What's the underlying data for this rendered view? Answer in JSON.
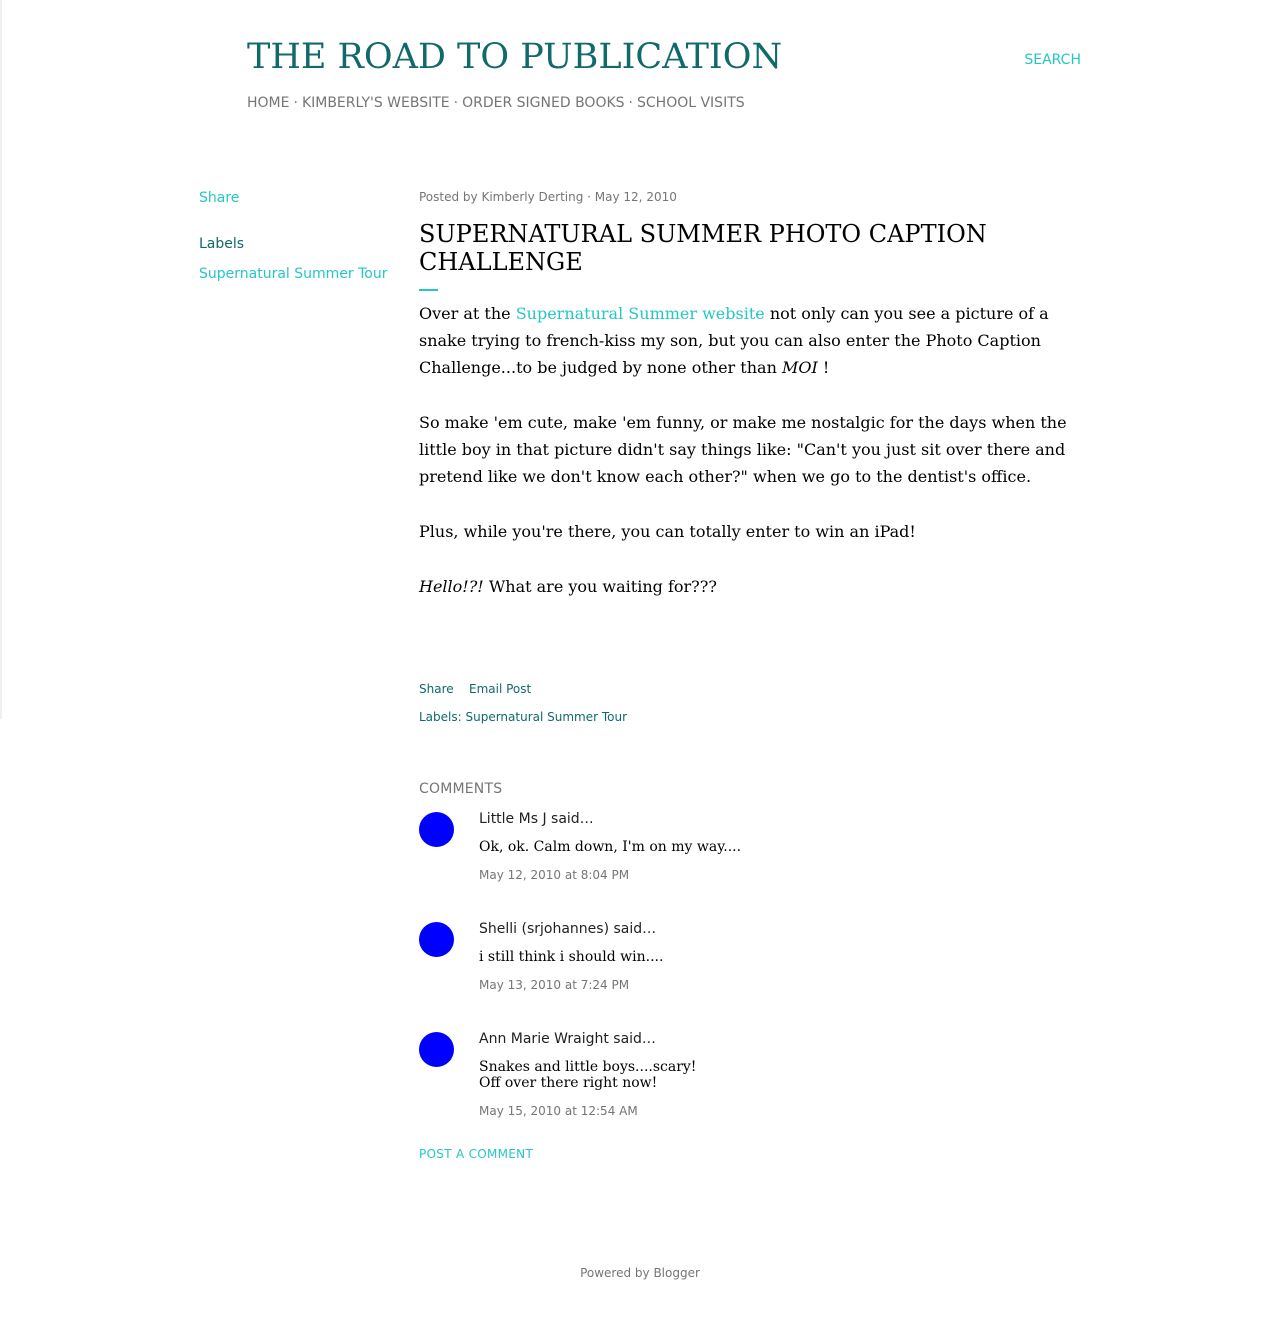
{
  "header": {
    "site_title": "THE ROAD TO PUBLICATION",
    "search_label": "SEARCH",
    "nav": [
      "HOME",
      "KIMBERLY'S WEBSITE",
      "ORDER SIGNED BOOKS",
      "SCHOOL VISITS"
    ],
    "nav_separator": "·"
  },
  "sidebar": {
    "share_label": "Share",
    "labels_title": "Labels",
    "label_link": "Supernatural Summer Tour"
  },
  "post": {
    "byline": "Posted by Kimberly Derting · May 12, 2010",
    "title": "SUPERNATURAL SUMMER PHOTO CAPTION CHALLENGE",
    "p1_before": "Over at the ",
    "p1_link": "Supernatural Summer website",
    "p1_after": " not only can you see a picture of a snake trying to french-kiss my son, but you can also enter the Photo Caption Challenge...to be judged by none other than ",
    "p1_emph": "MOI",
    "p1_end": " !",
    "p2": "So make 'em cute, make 'em funny, or make me nostalgic for the days when the little boy in that picture didn't say things like: \"Can't you just sit over there and pretend like we don't know each other?\" when we go to the dentist's office.",
    "p3": "Plus, while you're there, you can totally enter to win an iPad!",
    "p4_emph": "Hello!?!",
    "p4_rest": " What are you waiting for???",
    "footer_share": "Share",
    "footer_email": "Email Post",
    "footer_labels": "Labels: Supernatural Summer Tour"
  },
  "comments": {
    "heading": "COMMENTS",
    "items": [
      {
        "author": "Little Ms J said…",
        "text": [
          "Ok, ok. Calm down, I'm on my way...."
        ],
        "date": "May 12, 2010 at 8:04 PM"
      },
      {
        "author": "Shelli (srjohannes) said…",
        "text": [
          "i still think i should win...."
        ],
        "date": "May 13, 2010 at 7:24 PM"
      },
      {
        "author": "Ann Marie Wraight said…",
        "text": [
          "Snakes and little boys....scary!",
          "Off over there right now!"
        ],
        "date": "May 15, 2010 at 12:54 AM"
      }
    ],
    "post_comment_label": "POST A COMMENT"
  },
  "footer": {
    "powered_by": "Powered by Blogger"
  },
  "colors": {
    "accent": "#24c7c4",
    "title": "#10696b",
    "avatar": "#0000ff"
  }
}
